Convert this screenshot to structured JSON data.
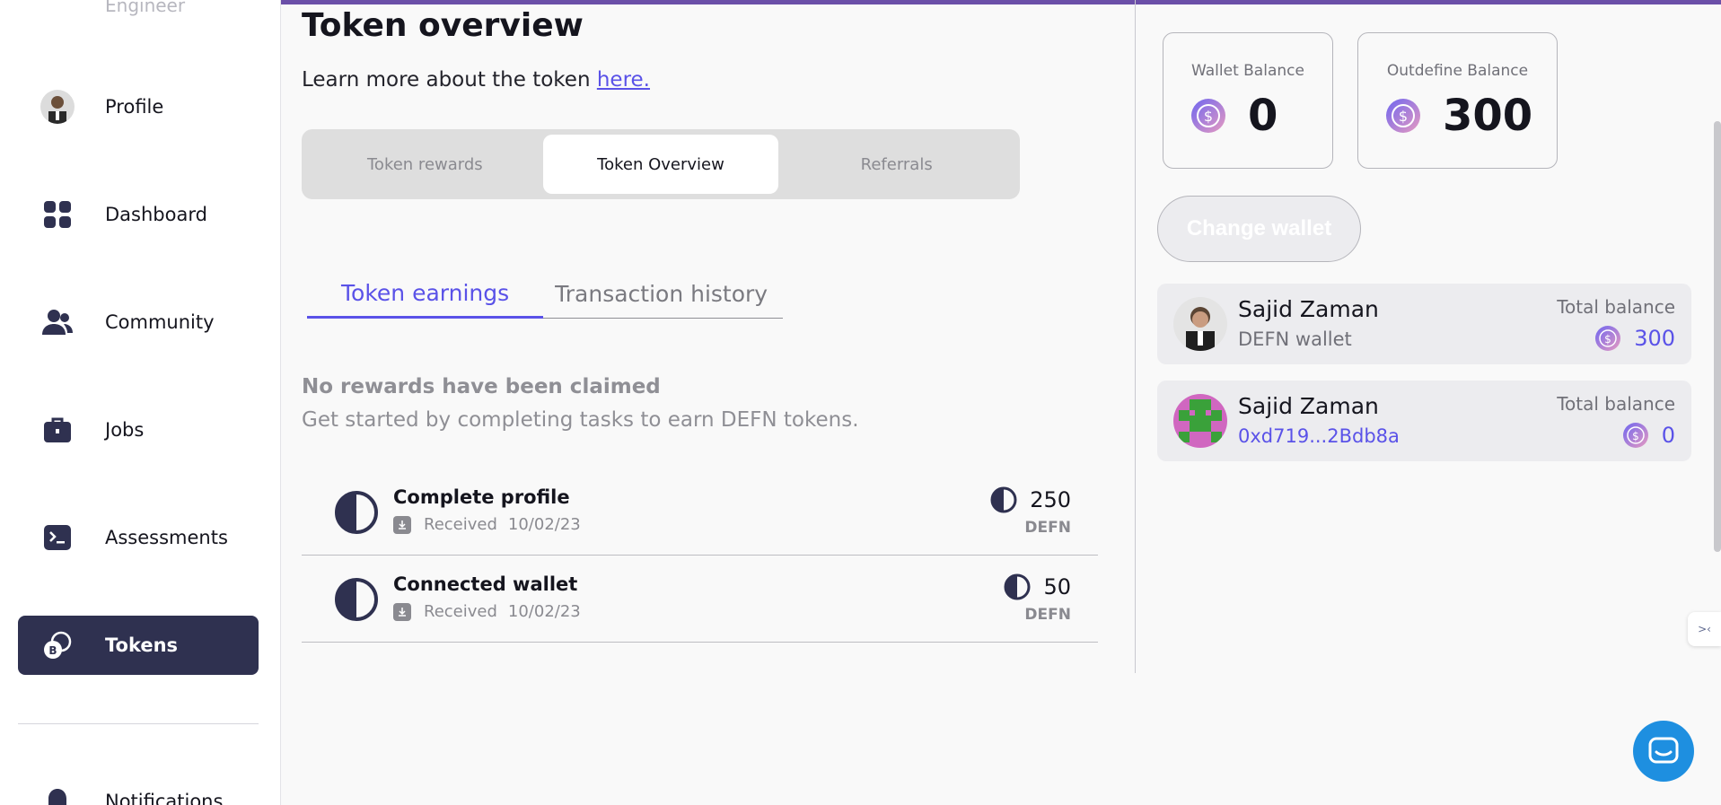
{
  "sidebar": {
    "cut_text": "Engineer",
    "items": [
      {
        "label": "Profile",
        "icon": "avatar"
      },
      {
        "label": "Dashboard",
        "icon": "grid-icon"
      },
      {
        "label": "Community",
        "icon": "users-icon"
      },
      {
        "label": "Jobs",
        "icon": "briefcase-icon"
      },
      {
        "label": "Assessments",
        "icon": "terminal-icon"
      },
      {
        "label": "Tokens",
        "icon": "tokens-icon",
        "active": true
      },
      {
        "label": "Notifications",
        "icon": "bell-icon"
      }
    ]
  },
  "main": {
    "title": "Token overview",
    "learn_text": "Learn more about the token",
    "learn_link": "here.",
    "segments": [
      "Token rewards",
      "Token Overview",
      "Referrals"
    ],
    "subtabs": [
      "Token earnings",
      "Transaction history"
    ],
    "empty_title": "No rewards have been claimed",
    "empty_sub": "Get started by completing tasks to earn DEFN tokens.",
    "rewards": [
      {
        "name": "Complete profile",
        "status": "Received",
        "date": "10/02/23",
        "amount": "250",
        "unit": "DEFN"
      },
      {
        "name": "Connected wallet",
        "status": "Received",
        "date": "10/02/23",
        "amount": "50",
        "unit": "DEFN"
      }
    ]
  },
  "right": {
    "wallet_balance_label": "Wallet Balance",
    "wallet_balance_value": "0",
    "outdefine_balance_label": "Outdefine Balance",
    "outdefine_balance_value": "300",
    "change_wallet_label": "Change wallet",
    "wallets": [
      {
        "name": "Sajid Zaman",
        "sub": "DEFN wallet",
        "total_label": "Total balance",
        "total": "300"
      },
      {
        "name": "Sajid Zaman",
        "sub": "0xd719...2Bdb8a",
        "total_label": "Total balance",
        "total": "0"
      }
    ]
  },
  "colors": {
    "accent": "#5a52e8",
    "nav_active": "#2f3150",
    "top_bar": "#6b4fa8",
    "chat": "#1e8fe0"
  }
}
